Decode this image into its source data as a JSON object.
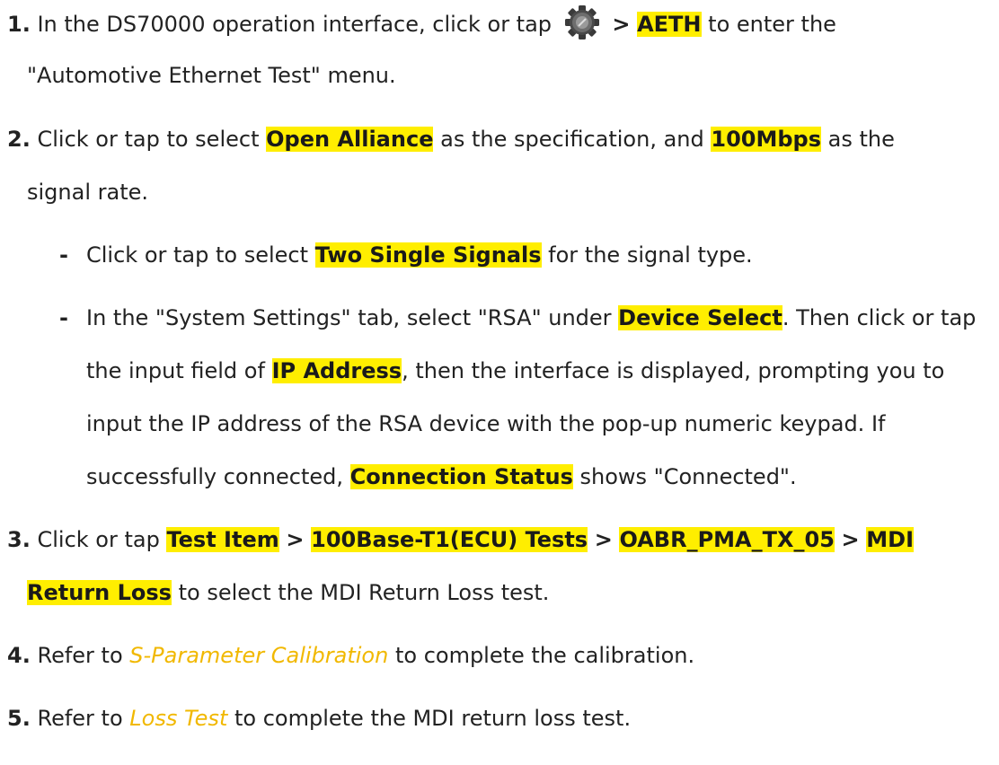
{
  "colors": {
    "highlight": "#ffee00",
    "link": "#f1b800",
    "text": "#222222"
  },
  "steps": [
    {
      "num": "1.",
      "l1_a": "In the DS70000 operation interface, click or tap",
      "icon": "gear-settings-icon",
      "sep": ">",
      "hl": "AETH",
      "l1_b": "to enter the",
      "l2": "\"Automotive Ethernet Test\" menu."
    },
    {
      "num": "2.",
      "l1_a": "Click or tap to select",
      "hl1": "Open Alliance",
      "l1_b": "as the specification, and",
      "hl2": "100Mbps",
      "l1_c": "as the",
      "l2": "signal rate."
    },
    {
      "num": "3.",
      "l1_a": "Click or tap",
      "hl1": "Test Item",
      "hl2": "100Base-T1(ECU) Tests",
      "hl3": "OABR_PMA_TX_05",
      "hl4a": "MDI",
      "hl4b": "Return Loss",
      "l2": "to select the MDI Return Loss test.",
      "sep": ">"
    },
    {
      "num": "4.",
      "a": "Refer to",
      "link": "S-Parameter Calibration",
      "b": "to complete the calibration."
    },
    {
      "num": "5.",
      "a": "Refer to",
      "link": "Loss Test",
      "b": "to complete the MDI return loss test."
    }
  ],
  "substeps": [
    {
      "dash": "-",
      "a": "Click or tap to select",
      "hl": "Two Single Signals",
      "b": "for the signal type."
    },
    {
      "dash": "-",
      "l1_a": "In the \"System Settings\" tab, select \"RSA\" under",
      "hl1": "Device Select",
      "l1_b": ". Then click or tap",
      "l2_a": "the input field of",
      "hl2": "IP Address",
      "l2_b": ", then the interface is displayed, prompting you to",
      "l3": "input the IP address of the RSA device with the pop-up numeric keypad. If",
      "l4_a": "successfully connected,",
      "hl3": "Connection Status",
      "l4_b": "shows \"Connected\"."
    }
  ]
}
